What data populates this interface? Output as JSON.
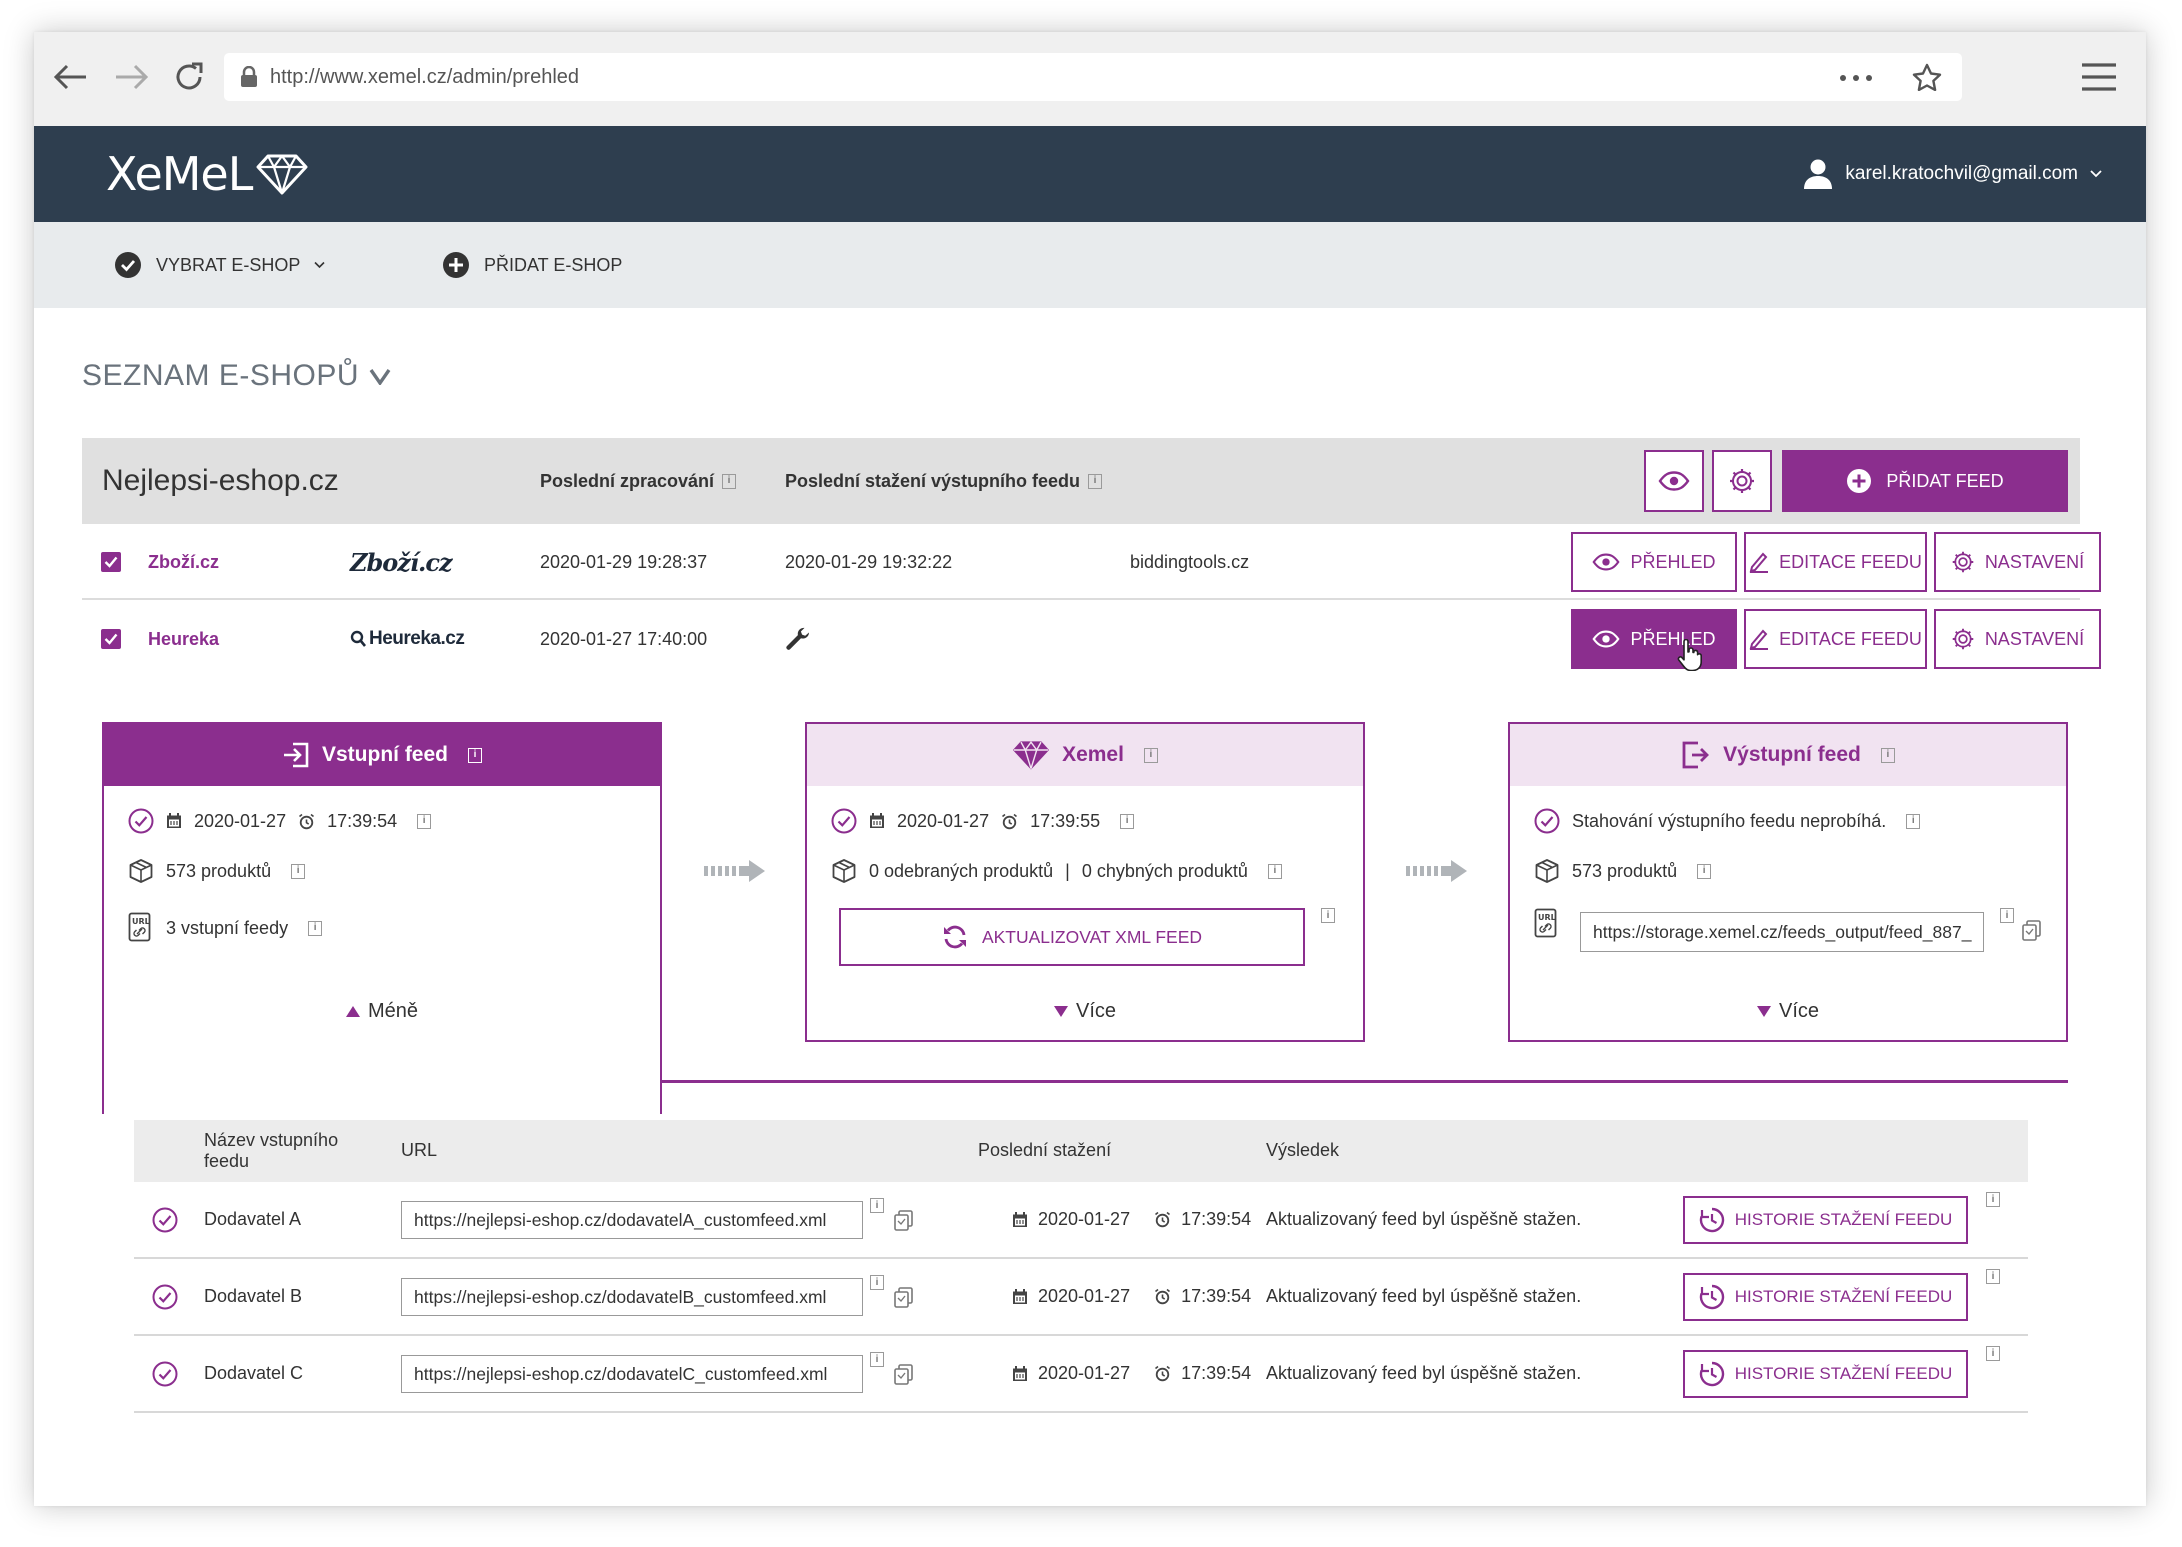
{
  "browser": {
    "url": "http://www.xemel.cz/admin/prehled"
  },
  "app": {
    "logo": "XeMeL",
    "user_email": "karel.kratochvil@gmail.com"
  },
  "subnav": {
    "select_shop": "VYBRAT E-SHOP",
    "add_shop": "PŘIDAT E-SHOP"
  },
  "page": {
    "title": "SEZNAM E-SHOPŮ"
  },
  "shop": {
    "name": "Nejlepsi-eshop.cz",
    "col_processed": "Poslední zpracování",
    "col_downloaded": "Poslední stažení výstupního feedu",
    "add_feed": "PŘIDAT FEED"
  },
  "feeds": [
    {
      "name": "Zboží.cz",
      "logo": "Zboží.cz",
      "processed": "2020-01-29 19:28:37",
      "downloaded": "2020-01-29 19:32:22",
      "source": "biddingtools.cz"
    },
    {
      "name": "Heureka",
      "logo": "Heureka.cz",
      "processed": "2020-01-27 17:40:00",
      "downloaded": "",
      "source": ""
    }
  ],
  "row_buttons": {
    "overview": "PŘEHLED",
    "edit": "EDITACE FEEDU",
    "settings": "NASTAVENÍ"
  },
  "panels": {
    "input": {
      "title": "Vstupní feed",
      "date": "2020-01-27",
      "time": "17:39:54",
      "products": "573 produktů",
      "feeds": "3 vstupní feedy",
      "toggle": "Méně"
    },
    "xemel": {
      "title": "Xemel",
      "date": "2020-01-27",
      "time": "17:39:55",
      "removed": "0 odebraných produktů",
      "separator": "|",
      "errors": "0 chybných produktů",
      "update_button": "AKTUALIZOVAT XML FEED",
      "toggle": "Více"
    },
    "output": {
      "title": "Výstupní feed",
      "status": "Stahování výstupního feedu neprobíhá.",
      "products": "573 produktů",
      "url": "https://storage.xemel.cz/feeds_output/feed_887_",
      "toggle": "Více"
    }
  },
  "input_table": {
    "headers": {
      "name": "Název vstupního feedu",
      "url": "URL",
      "last_download": "Poslední stažení",
      "result": "Výsledek"
    },
    "history_button": "HISTORIE STAŽENÍ FEEDU",
    "rows": [
      {
        "name": "Dodavatel A",
        "url": "https://nejlepsi-eshop.cz/dodavatelA_customfeed.xml",
        "date": "2020-01-27",
        "time": "17:39:54",
        "result": "Aktualizovaný feed byl úspěšně stažen."
      },
      {
        "name": "Dodavatel B",
        "url": "https://nejlepsi-eshop.cz/dodavatelB_customfeed.xml",
        "date": "2020-01-27",
        "time": "17:39:54",
        "result": "Aktualizovaný feed byl úspěšně stažen."
      },
      {
        "name": "Dodavatel C",
        "url": "https://nejlepsi-eshop.cz/dodavatelC_customfeed.xml",
        "date": "2020-01-27",
        "time": "17:39:54",
        "result": "Aktualizovaný feed byl úspěšně stažen."
      }
    ]
  },
  "colors": {
    "accent": "#8b2e8e",
    "topbar": "#2e3e4f",
    "accent_light": "#f1e3f1"
  }
}
